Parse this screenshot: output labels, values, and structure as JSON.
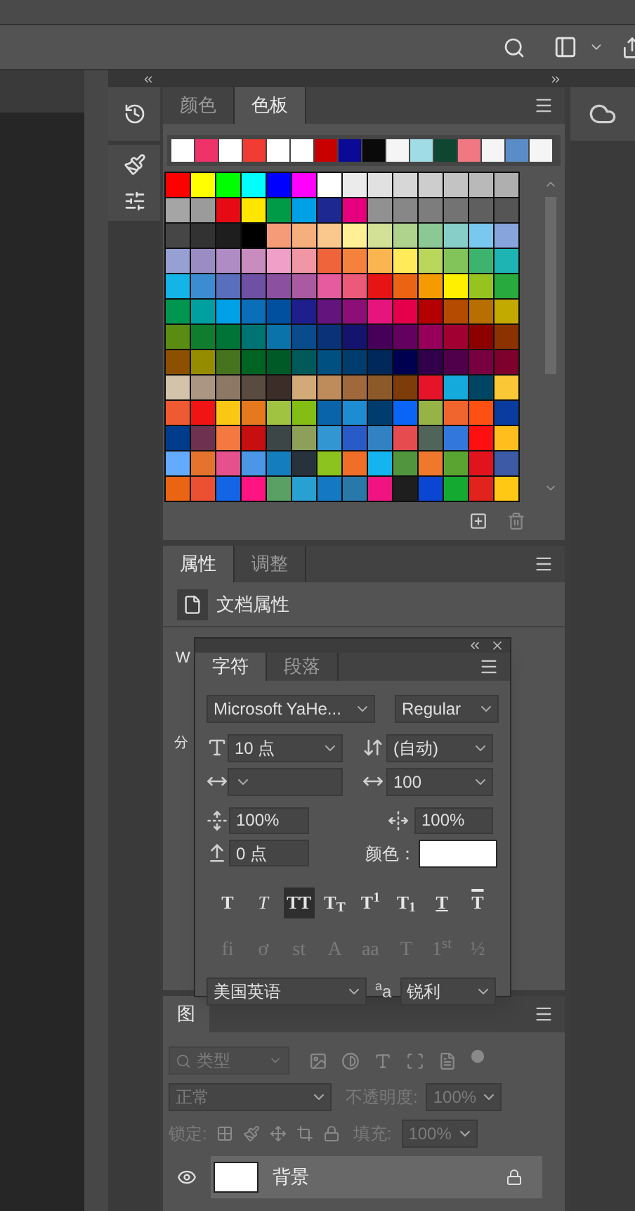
{
  "swatches_panel": {
    "tabs": [
      {
        "label": "颜色",
        "selected": false
      },
      {
        "label": "色板",
        "selected": true
      }
    ],
    "recent_colors": [
      {
        "color": "#ffffff"
      },
      {
        "color": "#f0326a"
      },
      {
        "color": "#ffffff"
      },
      {
        "color": "#f03c32"
      },
      {
        "color": "#ffffff"
      },
      {
        "color": "#ffffff"
      },
      {
        "color": "#c80000"
      },
      {
        "color": "#0a0a96"
      },
      {
        "color": "#0a0a0a"
      },
      {
        "color": "#f5f5f5"
      },
      {
        "color": "#a0dce6"
      },
      {
        "color": "#0f4632"
      },
      {
        "color": "#f07882"
      },
      {
        "color": "#f5f5f5"
      },
      {
        "color": "#5a8cc8"
      },
      {
        "color": "#f5f5f5"
      }
    ],
    "swatch_rows": [
      {
        "swatches": [
          {
            "color": "#ff0000"
          },
          {
            "color": "#ffff00"
          },
          {
            "color": "#00ff00"
          },
          {
            "color": "#00ffff"
          },
          {
            "color": "#0000ff"
          },
          {
            "color": "#ff00ff"
          },
          {
            "color": "#ffffff"
          },
          {
            "color": "#ebebeb"
          },
          {
            "color": "#e1e1e1"
          },
          {
            "color": "#d7d7d7"
          },
          {
            "color": "#cdcdcd"
          },
          {
            "color": "#c3c3c3"
          },
          {
            "color": "#b9b9b9"
          },
          {
            "color": "#afafaf"
          }
        ]
      },
      {
        "swatches": [
          {
            "color": "#a5a5a5"
          },
          {
            "color": "#9b9b9b"
          },
          {
            "color": "#e60a14"
          },
          {
            "color": "#ffe600"
          },
          {
            "color": "#009b46"
          },
          {
            "color": "#00a0e6"
          },
          {
            "color": "#1e2891"
          },
          {
            "color": "#e6007d"
          },
          {
            "color": "#919191"
          },
          {
            "color": "#878787"
          },
          {
            "color": "#7d7d7d"
          },
          {
            "color": "#737373"
          },
          {
            "color": "#5f5f5f"
          },
          {
            "color": "#555555"
          }
        ]
      },
      {
        "swatches": [
          {
            "color": "#464646"
          },
          {
            "color": "#323232"
          },
          {
            "color": "#1e1e1e"
          },
          {
            "color": "#000000"
          },
          {
            "color": "#f59b78"
          },
          {
            "color": "#f5af7d"
          },
          {
            "color": "#fac88c"
          },
          {
            "color": "#fff096"
          },
          {
            "color": "#d2e196"
          },
          {
            "color": "#afd28c"
          },
          {
            "color": "#8cc896"
          },
          {
            "color": "#87cdc8"
          },
          {
            "color": "#78c8f0"
          },
          {
            "color": "#87a5dc"
          }
        ]
      },
      {
        "swatches": [
          {
            "color": "#96a0d2"
          },
          {
            "color": "#9b8cc3"
          },
          {
            "color": "#af8cc3"
          },
          {
            "color": "#c88cbe"
          },
          {
            "color": "#f0a0c8"
          },
          {
            "color": "#f096a5"
          },
          {
            "color": "#f0643c"
          },
          {
            "color": "#f5823c"
          },
          {
            "color": "#fab450"
          },
          {
            "color": "#ffeb5a"
          },
          {
            "color": "#b9d75a"
          },
          {
            "color": "#82c35a"
          },
          {
            "color": "#3cb46e"
          },
          {
            "color": "#1eb4b4"
          }
        ]
      },
      {
        "swatches": [
          {
            "color": "#14b4e6"
          },
          {
            "color": "#3c8cd2"
          },
          {
            "color": "#5a6ebe"
          },
          {
            "color": "#6e50a5"
          },
          {
            "color": "#8c50a0"
          },
          {
            "color": "#aa5aa0"
          },
          {
            "color": "#e65aa0"
          },
          {
            "color": "#eb5a78"
          },
          {
            "color": "#e61414"
          },
          {
            "color": "#eb6414"
          },
          {
            "color": "#f59b00"
          },
          {
            "color": "#fff000"
          },
          {
            "color": "#96c31e"
          },
          {
            "color": "#28aa3c"
          }
        ]
      },
      {
        "swatches": [
          {
            "color": "#009650"
          },
          {
            "color": "#00a0a0"
          },
          {
            "color": "#00a0e6"
          },
          {
            "color": "#0a6eb9"
          },
          {
            "color": "#0050a0"
          },
          {
            "color": "#1e1e8c"
          },
          {
            "color": "#64147d"
          },
          {
            "color": "#8c0f78"
          },
          {
            "color": "#e6147d"
          },
          {
            "color": "#e6004b"
          },
          {
            "color": "#b40000"
          },
          {
            "color": "#b44b00"
          },
          {
            "color": "#b96e00"
          },
          {
            "color": "#c3aa00"
          }
        ]
      },
      {
        "swatches": [
          {
            "color": "#5a8c14"
          },
          {
            "color": "#0f7d2d"
          },
          {
            "color": "#007337"
          },
          {
            "color": "#007373"
          },
          {
            "color": "#0a73aa"
          },
          {
            "color": "#0a4b8c"
          },
          {
            "color": "#0a3278"
          },
          {
            "color": "#14146e"
          },
          {
            "color": "#46005a"
          },
          {
            "color": "#64005f"
          },
          {
            "color": "#96005a"
          },
          {
            "color": "#a00032"
          },
          {
            "color": "#8c0000"
          },
          {
            "color": "#8c3200"
          }
        ]
      },
      {
        "swatches": [
          {
            "color": "#8c5000"
          },
          {
            "color": "#968c00"
          },
          {
            "color": "#46731e"
          },
          {
            "color": "#006423"
          },
          {
            "color": "#005a28"
          },
          {
            "color": "#005a5a"
          },
          {
            "color": "#005082"
          },
          {
            "color": "#003c6e"
          },
          {
            "color": "#00285a"
          },
          {
            "color": "#000050"
          },
          {
            "color": "#32004b"
          },
          {
            "color": "#50004b"
          },
          {
            "color": "#780041"
          },
          {
            "color": "#7d002d"
          }
        ]
      },
      {
        "swatches": [
          {
            "color": "#d2c3aa"
          },
          {
            "color": "#aa9682"
          },
          {
            "color": "#8c7864"
          },
          {
            "color": "#5a4b41"
          },
          {
            "color": "#3c2d28"
          },
          {
            "color": "#d2aa78"
          },
          {
            "color": "#be8c5a"
          },
          {
            "color": "#a0693c"
          },
          {
            "color": "#8c5a28"
          },
          {
            "color": "#7d3c0a"
          },
          {
            "color": "#e61428"
          },
          {
            "color": "#14aadc"
          },
          {
            "color": "#004664"
          },
          {
            "color": "#fac837"
          }
        ]
      },
      {
        "swatches": [
          {
            "color": "#f05a32"
          },
          {
            "color": "#f01414"
          },
          {
            "color": "#fac814"
          },
          {
            "color": "#e6781e"
          },
          {
            "color": "#a0c341"
          },
          {
            "color": "#82be14"
          },
          {
            "color": "#0a64aa"
          },
          {
            "color": "#1e8cd2"
          },
          {
            "color": "#003c6e"
          },
          {
            "color": "#0a64f5"
          },
          {
            "color": "#96b446"
          },
          {
            "color": "#f0642d"
          },
          {
            "color": "#ff5014"
          },
          {
            "color": "#0a3ca0"
          }
        ]
      },
      {
        "swatches": [
          {
            "color": "#003c8c"
          },
          {
            "color": "#6e3250"
          },
          {
            "color": "#f57841"
          },
          {
            "color": "#c80f0f"
          },
          {
            "color": "#3c4646"
          },
          {
            "color": "#8ca05a"
          },
          {
            "color": "#3296d2"
          },
          {
            "color": "#285ac8"
          },
          {
            "color": "#3282c3"
          },
          {
            "color": "#e64b50"
          },
          {
            "color": "#50645a"
          },
          {
            "color": "#3278dc"
          },
          {
            "color": "#ff0f0f"
          },
          {
            "color": "#ffbe1e"
          }
        ]
      },
      {
        "swatches": [
          {
            "color": "#64aaff"
          },
          {
            "color": "#e6732d"
          },
          {
            "color": "#e6508c"
          },
          {
            "color": "#4b96e6"
          },
          {
            "color": "#147dbe"
          },
          {
            "color": "#28323c"
          },
          {
            "color": "#8cc31e"
          },
          {
            "color": "#f06e28"
          },
          {
            "color": "#14b4f0"
          },
          {
            "color": "#50963c"
          },
          {
            "color": "#f0782d"
          },
          {
            "color": "#5aa532"
          },
          {
            "color": "#e1141e"
          },
          {
            "color": "#3c5aa5"
          }
        ]
      },
      {
        "swatches": [
          {
            "color": "#eb6414"
          },
          {
            "color": "#eb5032"
          },
          {
            "color": "#1464e6"
          },
          {
            "color": "#ff1482"
          },
          {
            "color": "#5aa064"
          },
          {
            "color": "#28a0d2"
          },
          {
            "color": "#1478c3"
          },
          {
            "color": "#2878aa"
          },
          {
            "color": "#f01482"
          },
          {
            "color": "#1e1e1e"
          },
          {
            "color": "#0a46d2"
          },
          {
            "color": "#14aa32"
          },
          {
            "color": "#e1231e"
          },
          {
            "color": "#ffc814"
          }
        ]
      }
    ]
  },
  "properties_panel": {
    "tabs": [
      {
        "label": "属性",
        "selected": true
      },
      {
        "label": "调整",
        "selected": false
      }
    ],
    "document_label": "文档属性",
    "partial_labels": [
      "W",
      "分"
    ]
  },
  "character_panel": {
    "tabs": [
      {
        "label": "字符",
        "selected": true
      },
      {
        "label": "段落",
        "selected": false
      }
    ],
    "font_family": "Microsoft YaHe...",
    "font_style": "Regular",
    "font_size": "10 点",
    "leading": "(自动)",
    "tracking": "100",
    "vertical_scale": "100%",
    "horizontal_scale": "100%",
    "baseline_shift": "0 点",
    "color_label": "颜色：",
    "color": "#ffffff",
    "style_buttons": [
      {
        "kind": "bold",
        "label": "T",
        "selected": false
      },
      {
        "kind": "italic",
        "label": "T",
        "selected": false
      },
      {
        "kind": "plain",
        "label": "TT",
        "selected": true
      },
      {
        "kind": "plain",
        "label": "T$_{T}$",
        "selected": false
      },
      {
        "kind": "plain",
        "label": "T$^{1}$",
        "selected": false
      },
      {
        "kind": "plain",
        "label": "T$_{1}$",
        "selected": false
      },
      {
        "kind": "underline",
        "label": "T",
        "selected": false
      },
      {
        "kind": "strike",
        "label": "T",
        "selected": false
      }
    ],
    "opentype_buttons": [
      {
        "label": "fi",
        "disabled": true
      },
      {
        "label": "ơ",
        "disabled": true
      },
      {
        "label": "st",
        "disabled": true
      },
      {
        "label": "A",
        "disabled": true
      },
      {
        "label": "aa",
        "disabled": true
      },
      {
        "label": "T",
        "disabled": true
      },
      {
        "label": "1$^{st}$",
        "disabled": true
      },
      {
        "label": "½",
        "disabled": true
      }
    ],
    "language": "美国英语",
    "antialias_label": "$^{a}$a",
    "antialias": "锐利"
  },
  "layers_panel": {
    "tab_label": "图",
    "filter": "类型",
    "controls_disabled": true,
    "blend_mode": "正常",
    "opacity_label": "不透明度:",
    "opacity": "100%",
    "lock_label": "锁定:",
    "fill_label": "填充:",
    "fill": "100%",
    "layers": [
      {
        "name": "背景",
        "visible": true,
        "locked": true,
        "selected": true
      }
    ]
  }
}
